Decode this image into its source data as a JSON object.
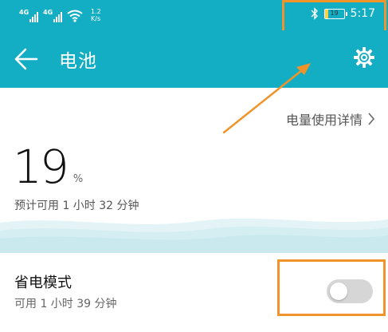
{
  "status_bar": {
    "signal1_label": "4G",
    "signal2_label": "4G",
    "net_speed_value": "1.2",
    "net_speed_unit": "K/s",
    "battery_level": "19",
    "time": "5:17",
    "icons": [
      "signal-icon",
      "wifi-icon",
      "bluetooth-icon",
      "battery-icon"
    ]
  },
  "header": {
    "title": "电池",
    "back_icon": "back-arrow-icon",
    "settings_icon": "gear-icon"
  },
  "main": {
    "usage_details_link": "电量使用详情",
    "battery_percent": "19",
    "percent_sign": "%",
    "estimated_remaining": "预计可用 1 小时 32 分钟",
    "power_saving": {
      "title": "省电模式",
      "subtitle": "可用 1 小时 39 分钟",
      "enabled": false
    }
  },
  "colors": {
    "accent": "#14aec4",
    "annotation": "#f0932b",
    "battery_fill": "#f5d24a"
  }
}
